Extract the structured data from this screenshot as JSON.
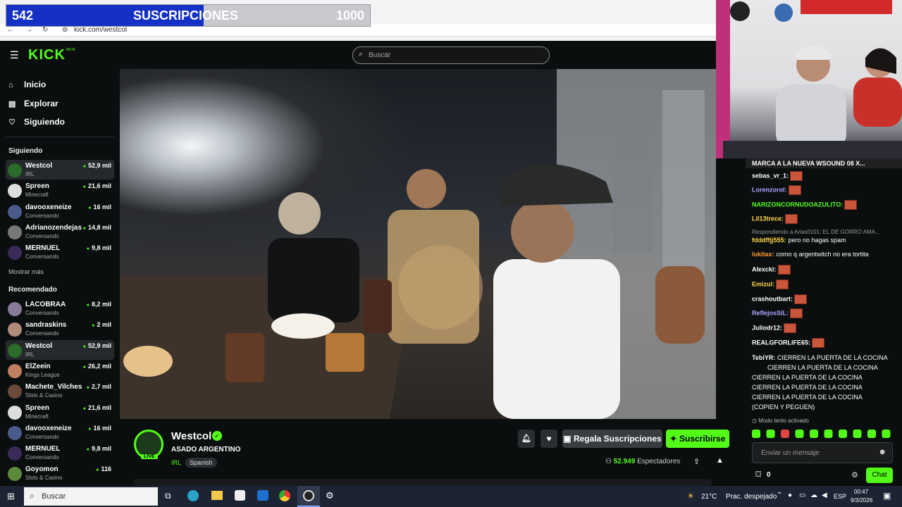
{
  "overlay": {
    "current": "542",
    "label": "SUSCRIPCIONES",
    "goal": "1000",
    "progress": 0.542
  },
  "browser": {
    "url": "kick.com/westcol"
  },
  "header": {
    "logo": "KICK",
    "logo_badge": "BETA",
    "search_placeholder": "Buscar"
  },
  "sidebar": {
    "nav": [
      {
        "label": "Inicio",
        "icon": "home-icon"
      },
      {
        "label": "Explorar",
        "icon": "explore-icon"
      },
      {
        "label": "Siguiendo",
        "icon": "heart-icon"
      }
    ],
    "following_title": "Siguiendo",
    "following": [
      {
        "name": "Westcol",
        "category": "IRL",
        "viewers": "52,9 mil",
        "color": "#2b6b2b"
      },
      {
        "name": "Spreen",
        "category": "Minecraft",
        "viewers": "21,6 mil",
        "color": "#dddddd"
      },
      {
        "name": "davooxeneize",
        "category": "Conversando",
        "viewers": "16 mil",
        "color": "#4a5a8a"
      },
      {
        "name": "Adrianozendejas",
        "category": "Conversando",
        "viewers": "14,8 mil",
        "color": "#777777"
      },
      {
        "name": "MERNUEL",
        "category": "Conversando",
        "viewers": "9,8 mil",
        "color": "#3a2a5a"
      }
    ],
    "show_more": "Mostrar más",
    "recommended_title": "Recomendado",
    "recommended": [
      {
        "name": "LACOBRAA",
        "category": "Conversando",
        "viewers": "8,2 mil",
        "color": "#8a7a9a"
      },
      {
        "name": "sandraskins",
        "category": "Conversando",
        "viewers": "2 mil",
        "color": "#b08a7a"
      },
      {
        "name": "Westcol",
        "category": "IRL",
        "viewers": "52,9 mil",
        "color": "#2b6b2b"
      },
      {
        "name": "ElZeein",
        "category": "Kings League",
        "viewers": "26,2 mil",
        "color": "#c08060"
      },
      {
        "name": "Machete_Vilches",
        "category": "Slots & Casino",
        "viewers": "2,7 mil",
        "color": "#6a4a3a"
      },
      {
        "name": "Spreen",
        "category": "Minecraft",
        "viewers": "21,6 mil",
        "color": "#dddddd"
      },
      {
        "name": "davooxeneize",
        "category": "Conversando",
        "viewers": "16 mil",
        "color": "#4a5a8a"
      },
      {
        "name": "MERNUEL",
        "category": "Conversando",
        "viewers": "9,8 mil",
        "color": "#3a2a5a"
      },
      {
        "name": "Goyomon",
        "category": "Slots & Casino",
        "viewers": "116",
        "color": "#5a8a3a"
      }
    ]
  },
  "stream": {
    "name": "Westcol",
    "title": "ASADO ARGENTINO",
    "category": "IRL",
    "language": "Spanish",
    "live_badge": "LIVE",
    "viewers": "52.949",
    "viewers_label": "Espectadores",
    "gift_label": "Regala Suscripciones",
    "subscribe_label": "Suscribirse"
  },
  "chat": {
    "pinned": "MARCA A LA NUEVA WSOUND 08 X...",
    "messages": [
      {
        "user": "sebas_vr_1:",
        "text": "",
        "color": "#ffffff",
        "emote": true
      },
      {
        "user": "Lorenzorol:",
        "text": "",
        "color": "#a8a8ff",
        "emote": true
      },
      {
        "user": "NARIZONCORNUDOAZULITO:",
        "text": "",
        "color": "#53fc18",
        "emote": true
      },
      {
        "user": "Lil13trece:",
        "text": "",
        "color": "#ffd84a",
        "emote": true
      },
      {
        "user": "fdddffjj555:",
        "text": "pero no hagas spam",
        "color": "#ffd84a",
        "emote": false
      },
      {
        "user": "lukitax:",
        "text": "como q argentwitch no era tortita",
        "color": "#ff9a3a",
        "emote": false
      },
      {
        "user": "Alexcki:",
        "text": "",
        "color": "#ffffff",
        "emote": true
      },
      {
        "user": "Emizul:",
        "text": "",
        "color": "#ffd84a",
        "emote": true
      },
      {
        "user": "crashoutbart:",
        "text": "",
        "color": "#ffffff",
        "emote": true
      },
      {
        "user": "ReflejosSiL:",
        "text": "",
        "color": "#a8a8ff",
        "emote": true
      },
      {
        "user": "Juliodr12:",
        "text": "",
        "color": "#ffffff",
        "emote": true
      },
      {
        "user": "REALGFORLIFE65:",
        "text": "",
        "color": "#ffffff",
        "emote": true
      }
    ],
    "reply_note": "Respondiendo a Arias0101: EL DE GORRO AMA...",
    "long_user": "TebiYR:",
    "long_lines": [
      "CIERREN LA PUERTA DE LA COCINA",
      "CIERREN LA PUERTA DE LA COCINA",
      "CIERREN LA PUERTA DE LA COCINA",
      "CIERREN LA PUERTA DE LA COCINA",
      "CIERREN LA PUERTA DE LA COCINA",
      "(COPIEN Y PEGUEN)"
    ],
    "slow_mode": "Modo lento activado",
    "input_placeholder": "Enviar un mensaje",
    "points": "0",
    "send_label": "Chat"
  },
  "taskbar": {
    "search": "Buscar",
    "weather_temp": "21°C",
    "weather_text": "Prac. despejado",
    "lang": "ESP",
    "time": "00:47",
    "date": "9/3/2026"
  },
  "colors": {
    "accent": "#53fc18",
    "background": "#0b0e0f",
    "overlay_blue": "#1530c4"
  }
}
